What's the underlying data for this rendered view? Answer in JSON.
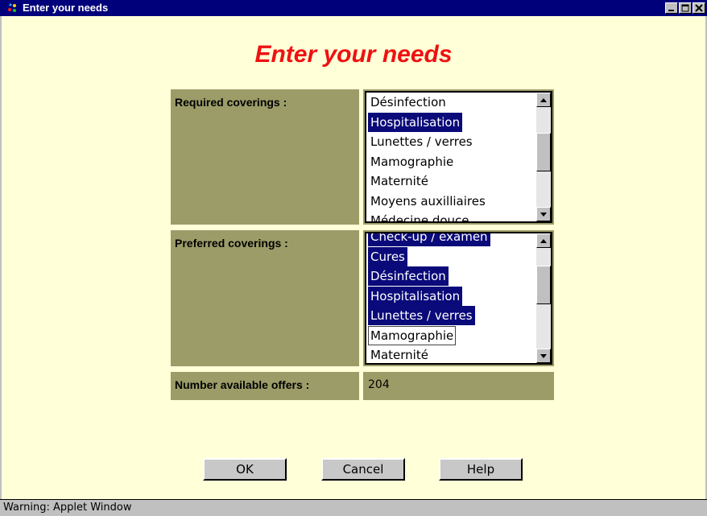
{
  "window": {
    "title": "Enter your needs",
    "controls": [
      "minimize",
      "maximize",
      "close"
    ]
  },
  "heading": "Enter your needs",
  "required": {
    "label": "Required coverings :",
    "items": [
      {
        "text": "Désinfection",
        "selected": false
      },
      {
        "text": "Hospitalisation",
        "selected": true
      },
      {
        "text": "Lunettes / verres",
        "selected": false
      },
      {
        "text": "Mamographie",
        "selected": false
      },
      {
        "text": "Maternité",
        "selected": false
      },
      {
        "text": "Moyens auxilliaires",
        "selected": false
      },
      {
        "text": "Médecine douce",
        "selected": false
      }
    ]
  },
  "preferred": {
    "label": "Preferred coverings :",
    "items": [
      {
        "text": "Check-up / examen",
        "selected": true
      },
      {
        "text": "Cures",
        "selected": true
      },
      {
        "text": "Désinfection",
        "selected": true
      },
      {
        "text": "Hospitalisation",
        "selected": true
      },
      {
        "text": "Lunettes / verres",
        "selected": true
      },
      {
        "text": "Mamographie",
        "selected": false,
        "focused": true
      },
      {
        "text": "Maternité",
        "selected": false
      }
    ]
  },
  "offers": {
    "label": "Number available offers :",
    "value": "204"
  },
  "buttons": {
    "ok": "OK",
    "cancel": "Cancel",
    "help": "Help"
  },
  "status": "Warning: Applet Window",
  "colors": {
    "background": "#ffffd8",
    "title_bar": "#00007b",
    "heading": "#ee1111",
    "label_box": "#9c9c68",
    "selection": "#0a0a7a"
  },
  "icons": {
    "app": "java-applet-icon",
    "scroll_up": "arrow-up-icon",
    "scroll_down": "arrow-down-icon"
  }
}
